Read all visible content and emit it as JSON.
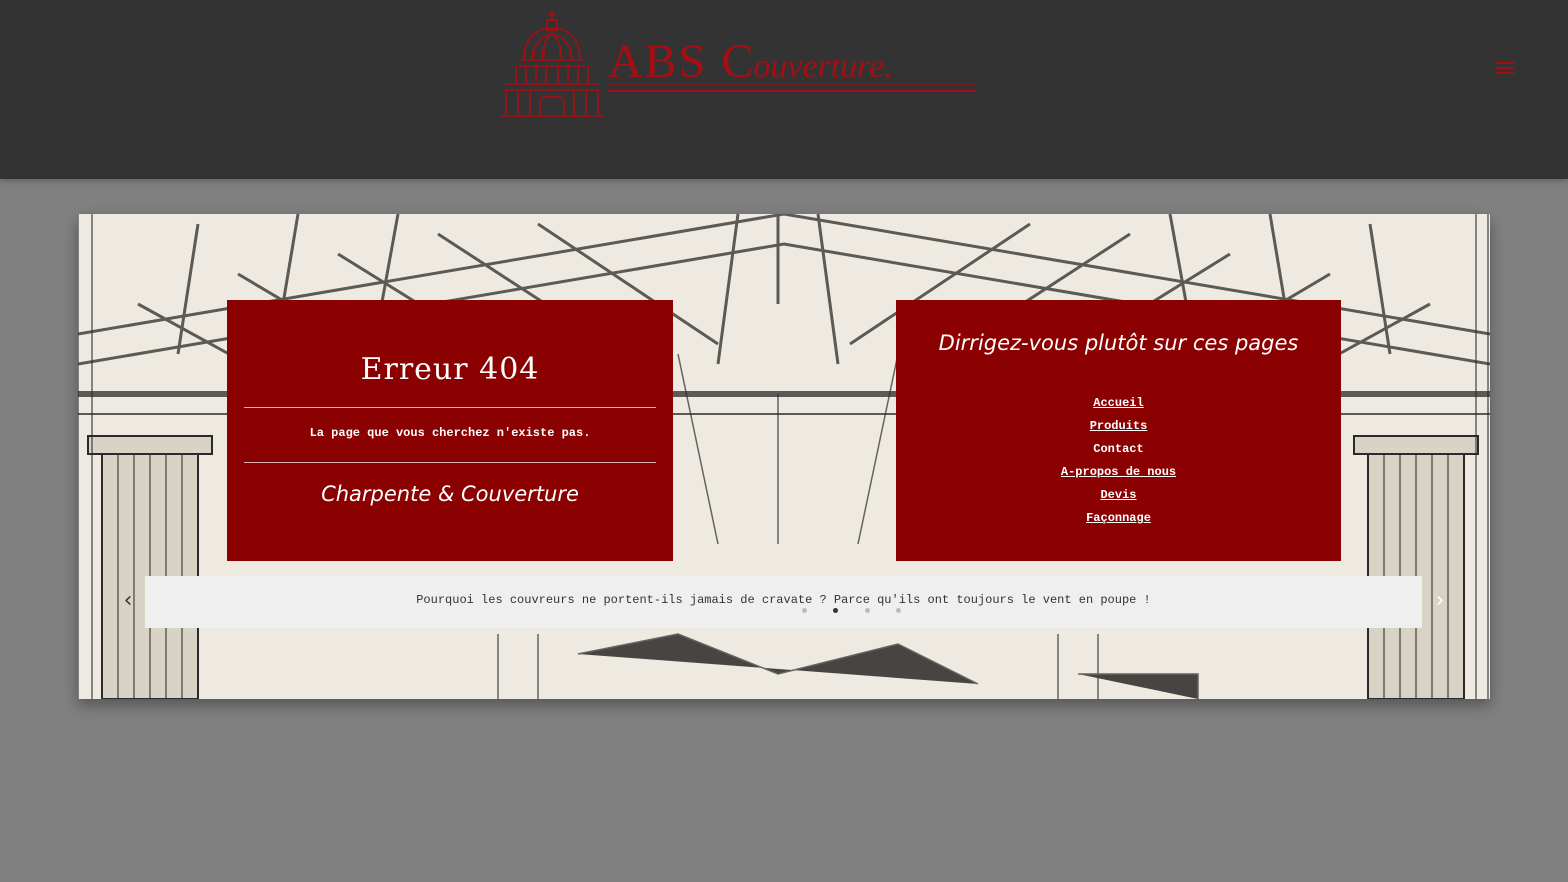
{
  "header": {
    "brand_main": "ABS ",
    "brand_cap": "C",
    "brand_rest": "ouverture."
  },
  "colors": {
    "header_bg": "#333333",
    "page_bg": "#808080",
    "accent": "#8b0000",
    "logo_red": "#a50e12"
  },
  "icons": {
    "menu": "hamburger-icon",
    "prev": "chevron-left-icon",
    "next": "chevron-right-icon"
  },
  "error_card": {
    "title": "Erreur 404",
    "message": "La page que vous cherchez n'existe pas.",
    "subtitle": "Charpente & Couverture"
  },
  "redirect_card": {
    "title": "Dirrigez-vous plutôt sur ces pages",
    "links": [
      "Accueil",
      "Produits",
      "Contact",
      "A-propos de nous",
      "Devis",
      "Façonnage"
    ]
  },
  "slider": {
    "quote": "Pourquoi les couvreurs ne portent-ils jamais de cravate ? Parce qu'ils ont toujours le vent en poupe !",
    "slide_count": 4,
    "active_slide": 2,
    "prev_glyph": "‹",
    "next_glyph": "›"
  }
}
